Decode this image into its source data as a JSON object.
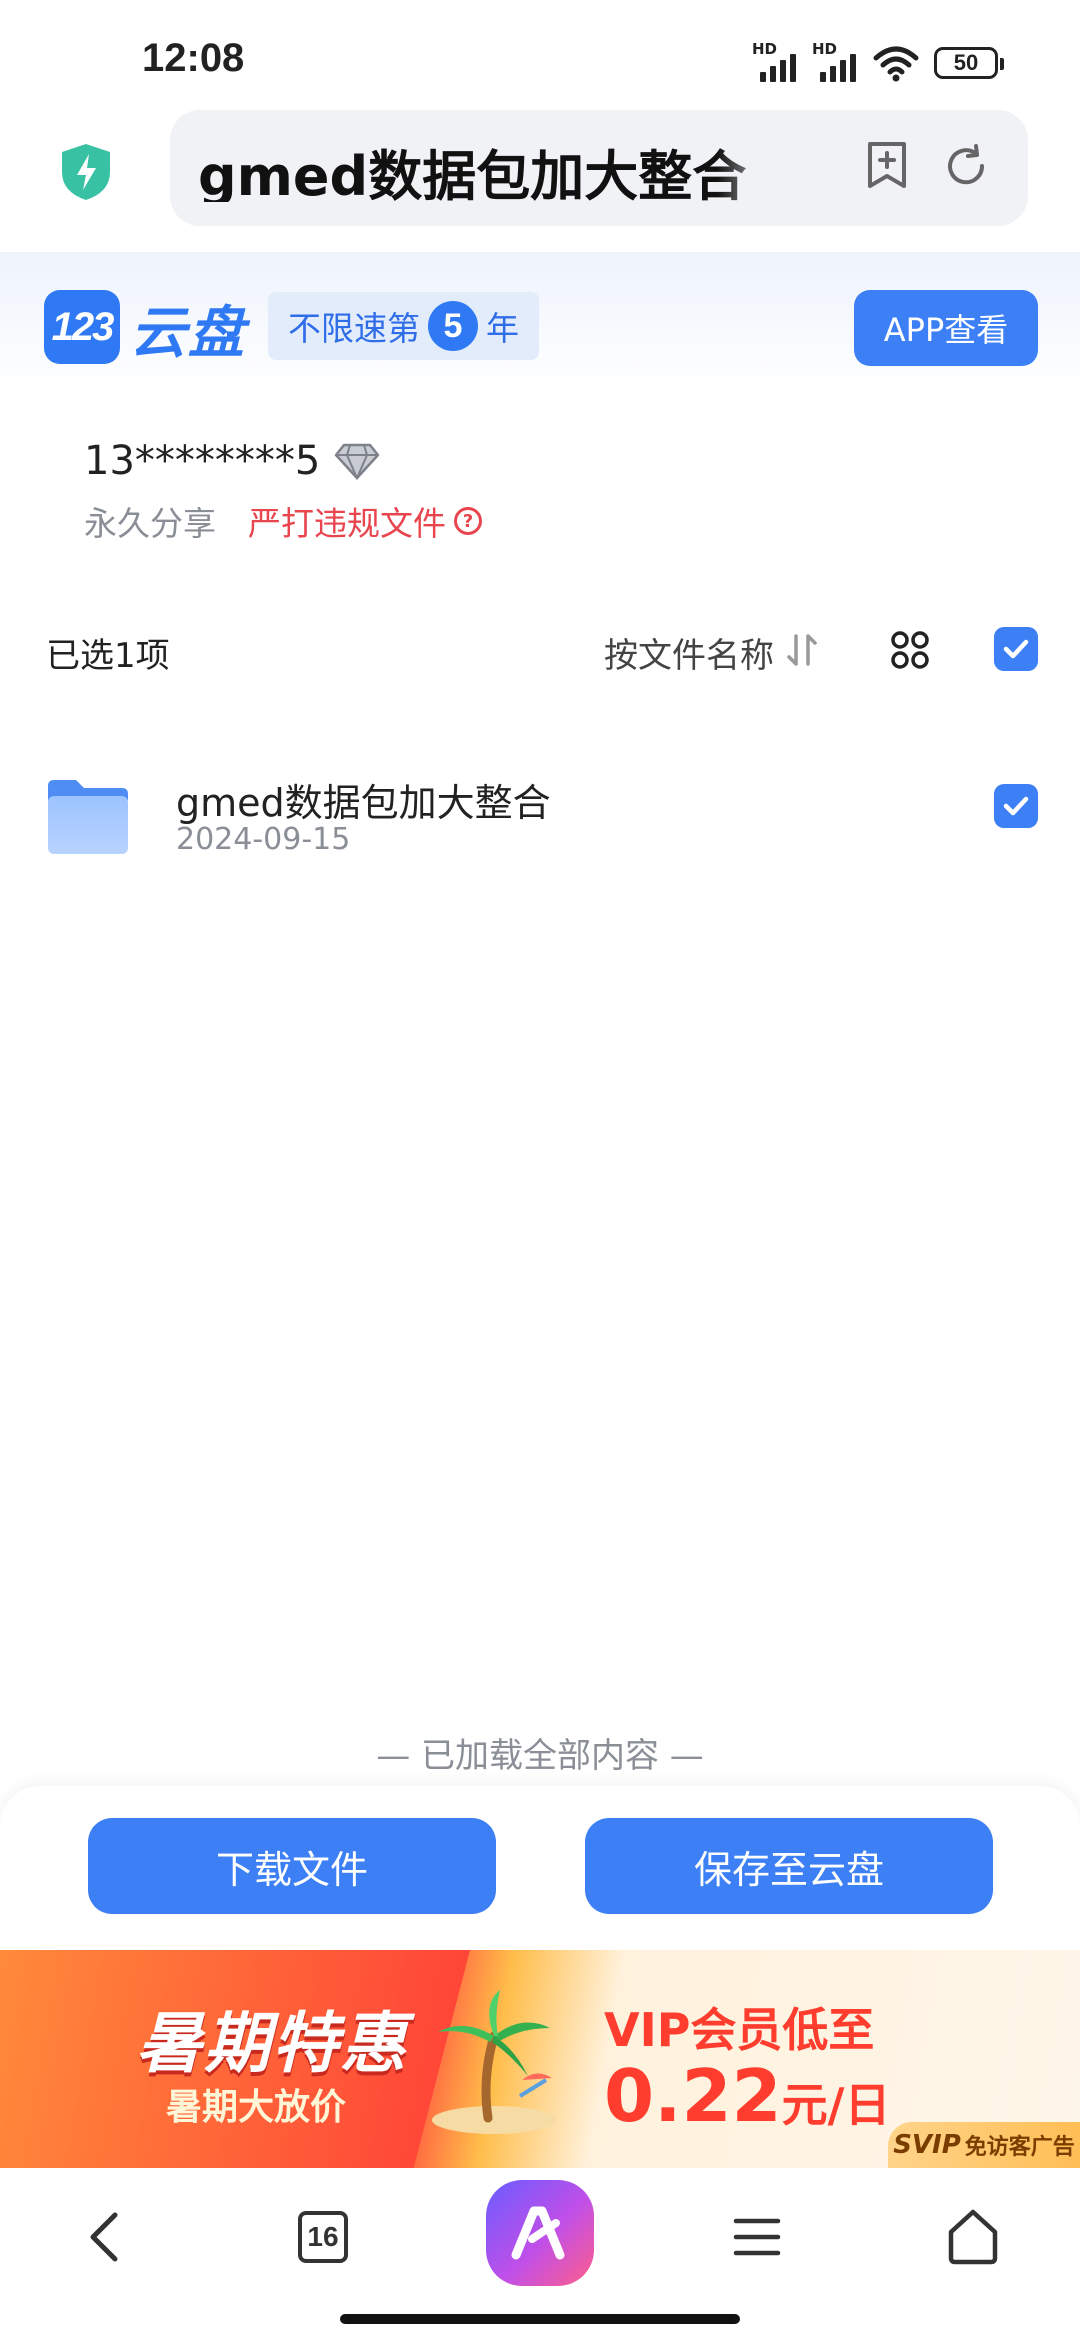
{
  "status_bar": {
    "time": "12:08",
    "signal1_label": "HD",
    "signal2_label": "HD",
    "battery": "50"
  },
  "url_bar": {
    "url_text": "gmed数据包加大整合_"
  },
  "header": {
    "logo_number": "123",
    "logo_text": "云盘",
    "badge_prefix": "不限速第",
    "badge_year": "5",
    "badge_suffix": "年",
    "app_button": "APP查看"
  },
  "share": {
    "owner": "13********5",
    "permission": "永久分享",
    "warning": "严打违规文件",
    "help_glyph": "?"
  },
  "toolbar": {
    "selected": "已选1项",
    "sort_label": "按文件名称"
  },
  "files": [
    {
      "name": "gmed数据包加大整合",
      "date": "2024-09-15",
      "checked": true
    }
  ],
  "footer": {
    "loaded_all": "— 已加载全部内容 —",
    "download_button": "下载文件",
    "save_button": "保存至云盘"
  },
  "ad": {
    "title": "暑期特惠",
    "subtitle": "暑期大放价",
    "vip_line": "VIP会员低至",
    "price": "0.22",
    "price_unit": "元/日",
    "tag_svip": "SVIP",
    "tag_text": "免访客广告"
  },
  "bottom_nav": {
    "tab_count": "16"
  },
  "colors": {
    "accent": "#3d80f6",
    "brand": "#2f7af4",
    "warning": "#e8454f",
    "muted": "#8a8e96"
  }
}
